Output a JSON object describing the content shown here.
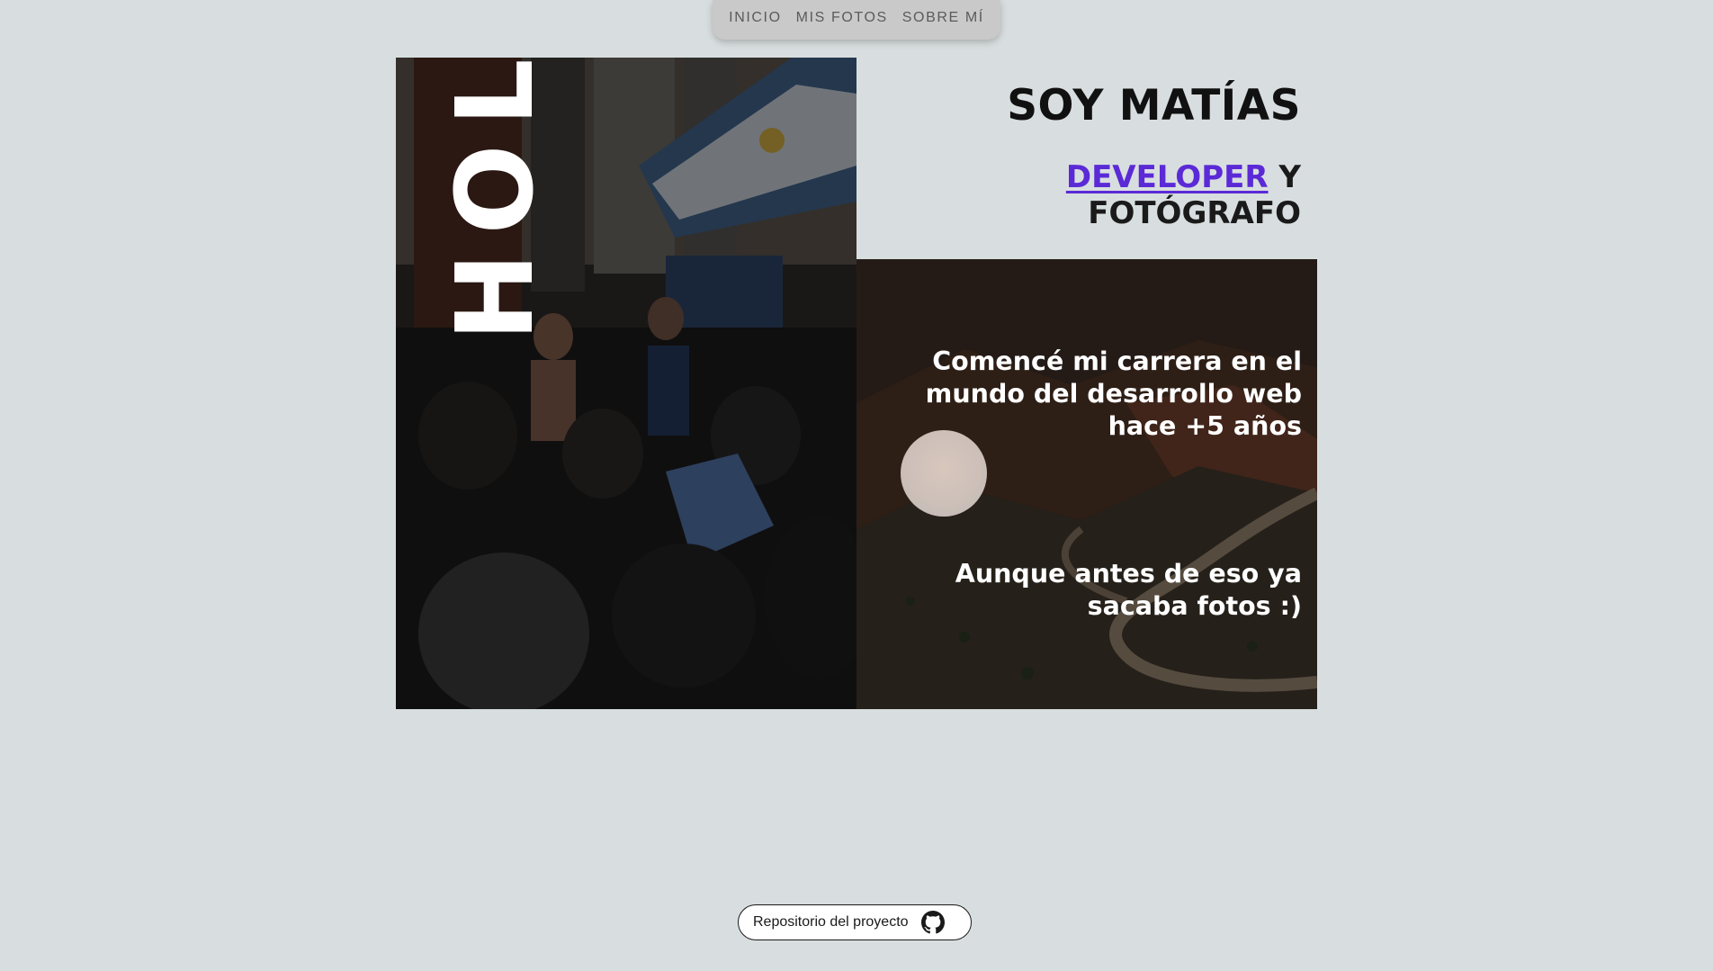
{
  "nav": {
    "items": [
      {
        "label": "INICIO"
      },
      {
        "label": "MIS FOTOS"
      },
      {
        "label": "SOBRE MÍ"
      }
    ]
  },
  "hero": {
    "greeting": "HOLA!",
    "name": "SOY MATÍAS",
    "role_link": "DEVELOPER",
    "role_y": "Y",
    "role_rest": "FOTÓGRAFO",
    "career_text": "Comencé mi carrera en el mundo del desarrollo web hace +5 años",
    "photo_text": "Aunque antes de eso ya sacaba fotos :)"
  },
  "footer": {
    "repo_label": "Repositorio del proyecto",
    "repo_icon": "github-icon"
  },
  "colors": {
    "page_background": "#d8dedf",
    "nav_background": "#c9c9c9",
    "link_accent": "#5b2ad6",
    "heading_text": "#111111",
    "overlay_text": "#ffffff"
  }
}
